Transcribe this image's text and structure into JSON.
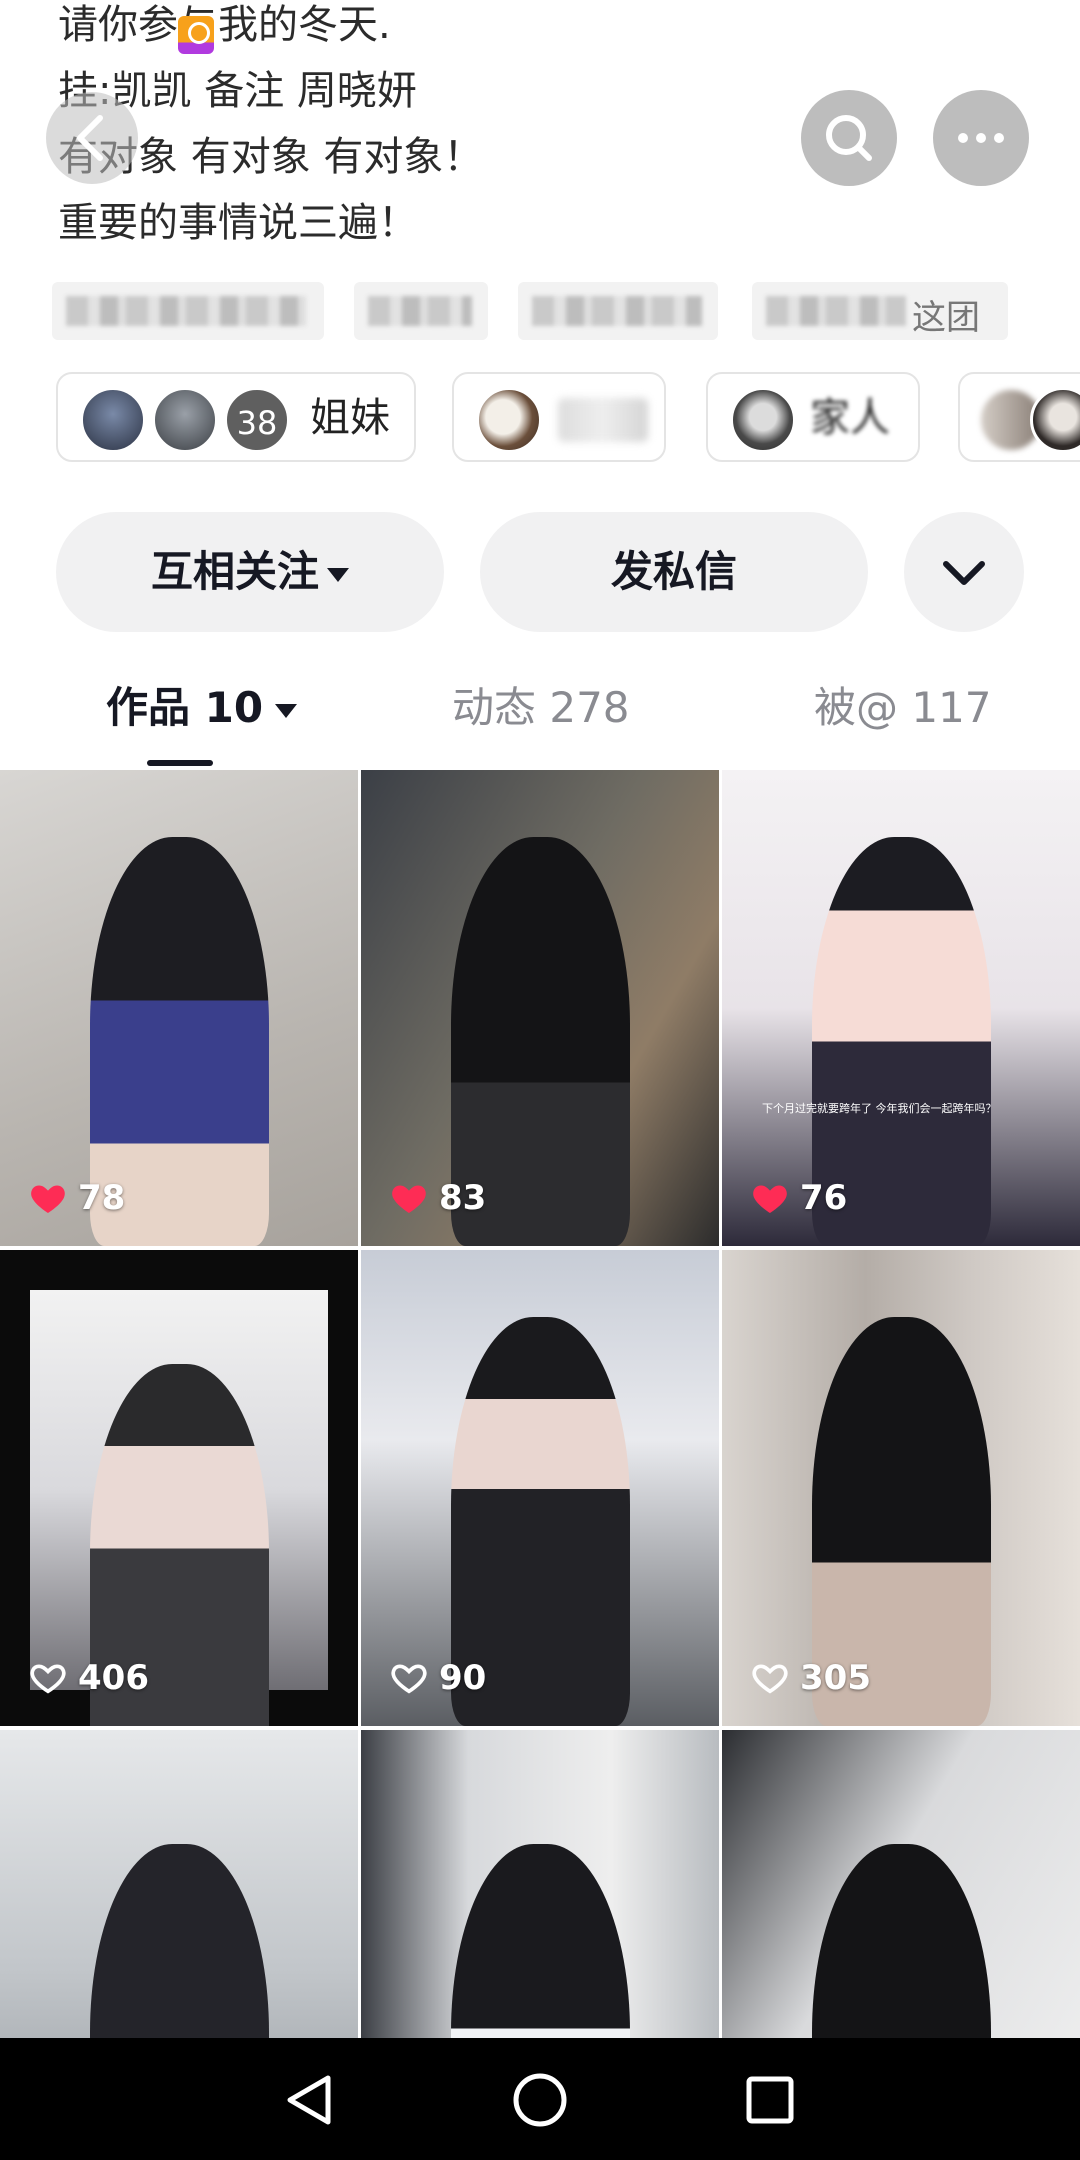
{
  "bio": {
    "lines": [
      "请你参与我的冬天.",
      "挂:凯凯   备注 周晓妍",
      "有对象 有对象 有对象！",
      "重要的事情说三遍！"
    ]
  },
  "tags": {
    "visible_suffix": "这团"
  },
  "groups": [
    {
      "name": "姐妹",
      "member_count": "38"
    },
    {
      "name": ""
    },
    {
      "name": "家人"
    },
    {
      "name": ""
    }
  ],
  "actions": {
    "follow_label": "互相关注",
    "message_label": "发私信"
  },
  "tabs": [
    {
      "label": "作品 10",
      "active": true
    },
    {
      "label": "动态 278",
      "active": false
    },
    {
      "label": "被@ 117",
      "active": false
    }
  ],
  "posts": [
    {
      "likes": "78",
      "liked": true,
      "caption": ""
    },
    {
      "likes": "83",
      "liked": true,
      "caption": ""
    },
    {
      "likes": "76",
      "liked": true,
      "caption": "下个月过完就要跨年了 今年我们会一起跨年吗？"
    },
    {
      "likes": "406",
      "liked": false,
      "caption": ""
    },
    {
      "likes": "90",
      "liked": false,
      "caption": ""
    },
    {
      "likes": "305",
      "liked": false,
      "caption": ""
    },
    {
      "likes": "",
      "liked": false,
      "caption": ""
    },
    {
      "likes": "",
      "liked": false,
      "caption": ""
    },
    {
      "likes": "",
      "liked": false,
      "caption": ""
    }
  ],
  "colors": {
    "like_red": "#fe2c55",
    "text_primary": "#161823",
    "text_secondary": "#8a8b91",
    "button_bg": "#f1f1f2"
  },
  "icons": {
    "back": "chevron-left-icon",
    "search": "search-icon",
    "more": "more-horizontal-icon",
    "expand": "chevron-down-icon",
    "like": "heart-icon",
    "nav_back": "triangle-back-icon",
    "nav_home": "circle-home-icon",
    "nav_recent": "square-recents-icon"
  }
}
